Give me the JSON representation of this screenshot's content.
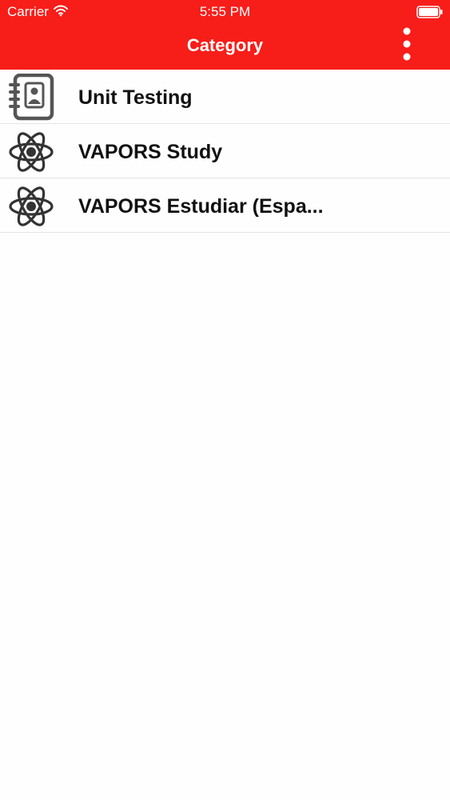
{
  "status_bar": {
    "carrier": "Carrier",
    "time": "5:55 PM",
    "wifi_icon": "wifi-icon",
    "battery_icon": "battery-icon"
  },
  "header": {
    "title": "Category",
    "menu_icon": "more-vertical-icon",
    "background_color": "#f71d19"
  },
  "categories": [
    {
      "label": "Unit Testing",
      "icon": "address-book-icon"
    },
    {
      "label": "VAPORS Study",
      "icon": "atom-icon"
    },
    {
      "label": "VAPORS Estudiar (Espa...",
      "icon": "atom-icon"
    }
  ]
}
